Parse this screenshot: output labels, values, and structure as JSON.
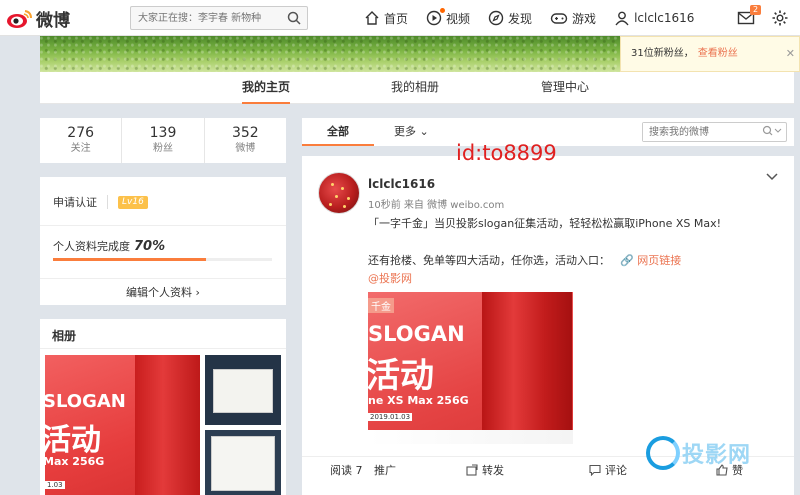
{
  "header": {
    "logo_text": "微博",
    "search_placeholder": "大家正在搜：李宇春 新物种",
    "nav": [
      {
        "label": "首页"
      },
      {
        "label": "视频"
      },
      {
        "label": "发现"
      },
      {
        "label": "游戏"
      },
      {
        "label": "lclclc1616"
      }
    ],
    "mail_badge": "2"
  },
  "notification": {
    "text": "31位新粉丝，",
    "link": "查看粉丝"
  },
  "tabs": [
    "我的主页",
    "我的相册",
    "管理中心"
  ],
  "stats": [
    {
      "num": "276",
      "label": "关注"
    },
    {
      "num": "139",
      "label": "粉丝"
    },
    {
      "num": "352",
      "label": "微博"
    }
  ],
  "verify": {
    "apply": "申请认证",
    "level": "Lv16",
    "completeness_label": "个人资料完成度",
    "completeness_value": "70%",
    "completeness_fraction": 0.7,
    "edit": "编辑个人资料"
  },
  "album": {
    "title": "相册",
    "main_photo": {
      "line1": "SLOGAN",
      "line2": "活动",
      "line3": "Max 256G",
      "line4": "1.03"
    }
  },
  "feed_filter": {
    "all": "全部",
    "more": "更多",
    "search_placeholder": "搜索我的微博"
  },
  "watermark_id": "id:to8899",
  "post": {
    "username": "lclclc1616",
    "meta": "10秒前 来自 微博 weibo.com",
    "text1": "「一字千金」当贝投影slogan征集活动，轻轻松松赢取iPhone XS Max!",
    "text2": "还有抢楼、免单等四大活动，任你选，活动入口：",
    "link": "网页链接",
    "mention": "@投影网",
    "image": {
      "tag": "千金",
      "line1": "SLOGAN",
      "line2": "活动",
      "line3": "ne XS Max 256G",
      "line4": "2019.01.03"
    },
    "actions": [
      {
        "label": "阅读 7"
      },
      {
        "label": "推广"
      },
      {
        "label": "转发"
      },
      {
        "label": "评论"
      },
      {
        "label": "赞"
      }
    ]
  },
  "site_watermark": "投影网"
}
